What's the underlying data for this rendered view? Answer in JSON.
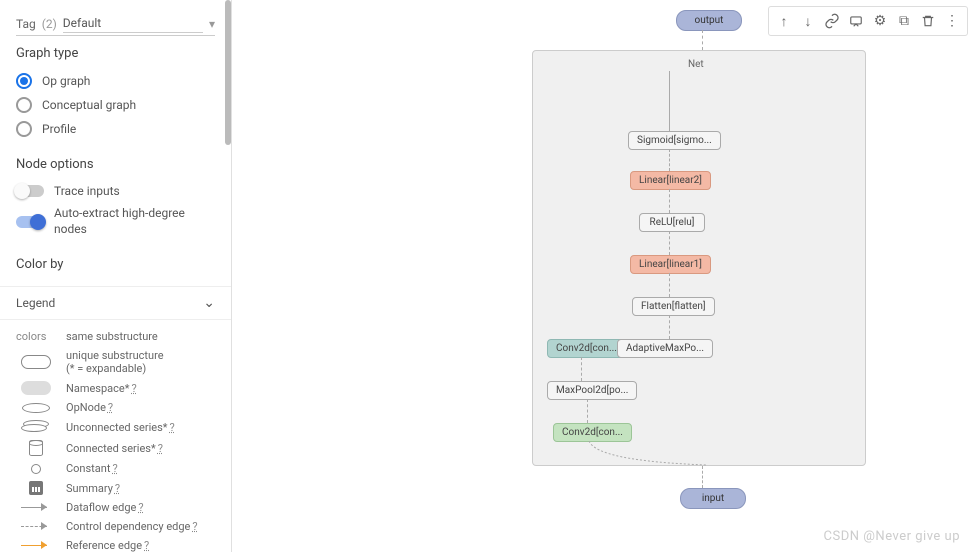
{
  "sidebar": {
    "tag": {
      "label": "Tag",
      "count": "(2)",
      "selected": "Default"
    },
    "graphType": {
      "title": "Graph type",
      "options": [
        "Op graph",
        "Conceptual graph",
        "Profile"
      ],
      "selectedIndex": 0
    },
    "nodeOptions": {
      "title": "Node options",
      "traceInputs": {
        "label": "Trace inputs",
        "on": false
      },
      "autoExtract": {
        "label": "Auto-extract high-degree nodes",
        "on": true
      }
    },
    "colorBy": "Color by",
    "legend": {
      "title": "Legend",
      "colHeaders": {
        "left": "colors",
        "right": "same substructure"
      },
      "items": [
        {
          "shape": "pill-outline",
          "label": "unique substructure",
          "sub": "(* = expandable)"
        },
        {
          "shape": "pill-filled",
          "label": "Namespace*",
          "q": true
        },
        {
          "shape": "ellipse",
          "label": "OpNode",
          "q": true
        },
        {
          "shape": "ellipse-stack",
          "label": "Unconnected series*",
          "q": true
        },
        {
          "shape": "db",
          "label": "Connected series*",
          "q": true
        },
        {
          "shape": "circle",
          "label": "Constant",
          "q": true
        },
        {
          "shape": "bars",
          "label": "Summary",
          "q": true
        },
        {
          "shape": "arrow",
          "label": "Dataflow edge",
          "q": true
        },
        {
          "shape": "arrow-dashed",
          "label": "Control dependency edge",
          "q": true
        },
        {
          "shape": "arrow-orange",
          "label": "Reference edge",
          "q": true
        }
      ]
    }
  },
  "graph": {
    "netLabel": "Net",
    "output": "output",
    "input": "input",
    "nodes": {
      "sigmoid": "Sigmoid[sigmo...",
      "linear2": "Linear[linear2]",
      "relu": "ReLU[relu]",
      "linear1": "Linear[linear1]",
      "flatten": "Flatten[flatten]",
      "conv2": "Conv2d[con...",
      "adaptivemax": "AdaptiveMaxPo...",
      "maxpool": "MaxPool2d[po...",
      "conv1": "Conv2d[con..."
    }
  },
  "toolbar": {
    "upload": "↑",
    "download": "↓",
    "link": "⊂⊃",
    "chat": "▭",
    "settings": "⚙",
    "restore": "⧉",
    "delete": "🗑",
    "more": "⋮"
  },
  "watermark": "CSDN @Never give up"
}
